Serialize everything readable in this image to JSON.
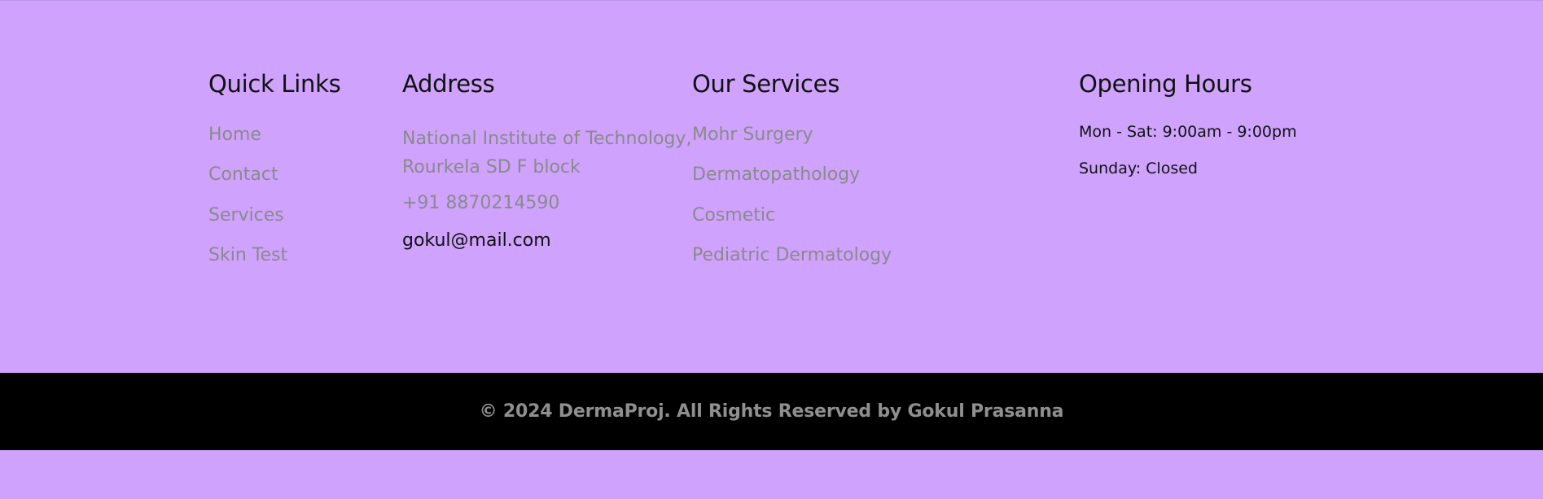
{
  "quick_links": {
    "title": "Quick Links",
    "items": [
      {
        "label": "Home"
      },
      {
        "label": "Contact"
      },
      {
        "label": "Services"
      },
      {
        "label": "Skin Test"
      }
    ]
  },
  "address": {
    "title": "Address",
    "line1": "National Institute of Technology,",
    "line2": "Rourkela SD F block",
    "phone": "+91 8870214590",
    "email": "gokul@mail.com"
  },
  "services": {
    "title": "Our Services",
    "items": [
      {
        "label": "Mohr Surgery"
      },
      {
        "label": "Dermatopathology"
      },
      {
        "label": "Cosmetic"
      },
      {
        "label": "Pediatric Dermatology"
      }
    ]
  },
  "hours": {
    "title": "Opening Hours",
    "weekdays": "Mon - Sat: 9:00am - 9:00pm",
    "sunday": "Sunday: Closed"
  },
  "footer": {
    "copyright": "© 2024 DermaProj. All Rights Reserved by Gokul Prasanna"
  },
  "colors": {
    "background": "#cfa2fd",
    "footer_bar": "#000000",
    "muted_text": "#8a8a8a",
    "heading_text": "#111111"
  }
}
